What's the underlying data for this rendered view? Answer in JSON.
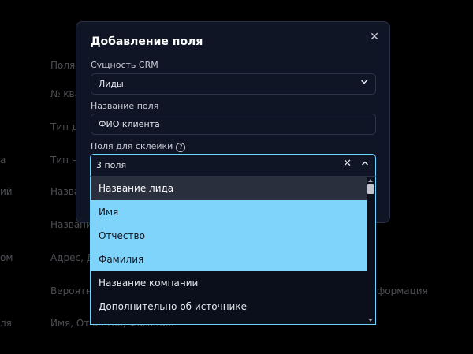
{
  "background_table": {
    "header": "Поля",
    "rows": [
      {
        "left": "",
        "mid": "№ ква"
      },
      {
        "left": "",
        "mid": "Тип до"
      },
      {
        "left": "а",
        "mid": "Тип не"
      },
      {
        "left": "ий",
        "mid": "Назва"
      },
      {
        "left": "",
        "mid": "Названи"
      },
      {
        "left": "ом",
        "mid": "Адрес, До"
      },
      {
        "left": "",
        "mid": "Вероятно",
        "right": "формация"
      },
      {
        "left": "ля",
        "mid": "Имя, Отчество, Фамилия"
      }
    ]
  },
  "modal": {
    "title": "Добавление поля",
    "entity_label": "Сущность CRM",
    "entity_value": "Лиды",
    "name_label": "Название поля",
    "name_value": "ФИО клиента",
    "merge_label": "Поля для склейки",
    "help_glyph": "?",
    "close_glyph": "✕"
  },
  "multiselect": {
    "value": "3 поля",
    "clear_glyph": "✕",
    "options": [
      {
        "label": "Название лида",
        "state": "hover"
      },
      {
        "label": "Имя",
        "state": "selected"
      },
      {
        "label": "Отчество",
        "state": "selected"
      },
      {
        "label": "Фамилия",
        "state": "selected"
      },
      {
        "label": "Название компании",
        "state": "normal"
      },
      {
        "label": "Дополнительно об источнике",
        "state": "normal"
      }
    ]
  },
  "colors": {
    "accent": "#6fd3ff",
    "selected_bg": "#7fd4fb",
    "hover_bg": "#2a2f3d",
    "modal_bg": "#0f1525"
  }
}
